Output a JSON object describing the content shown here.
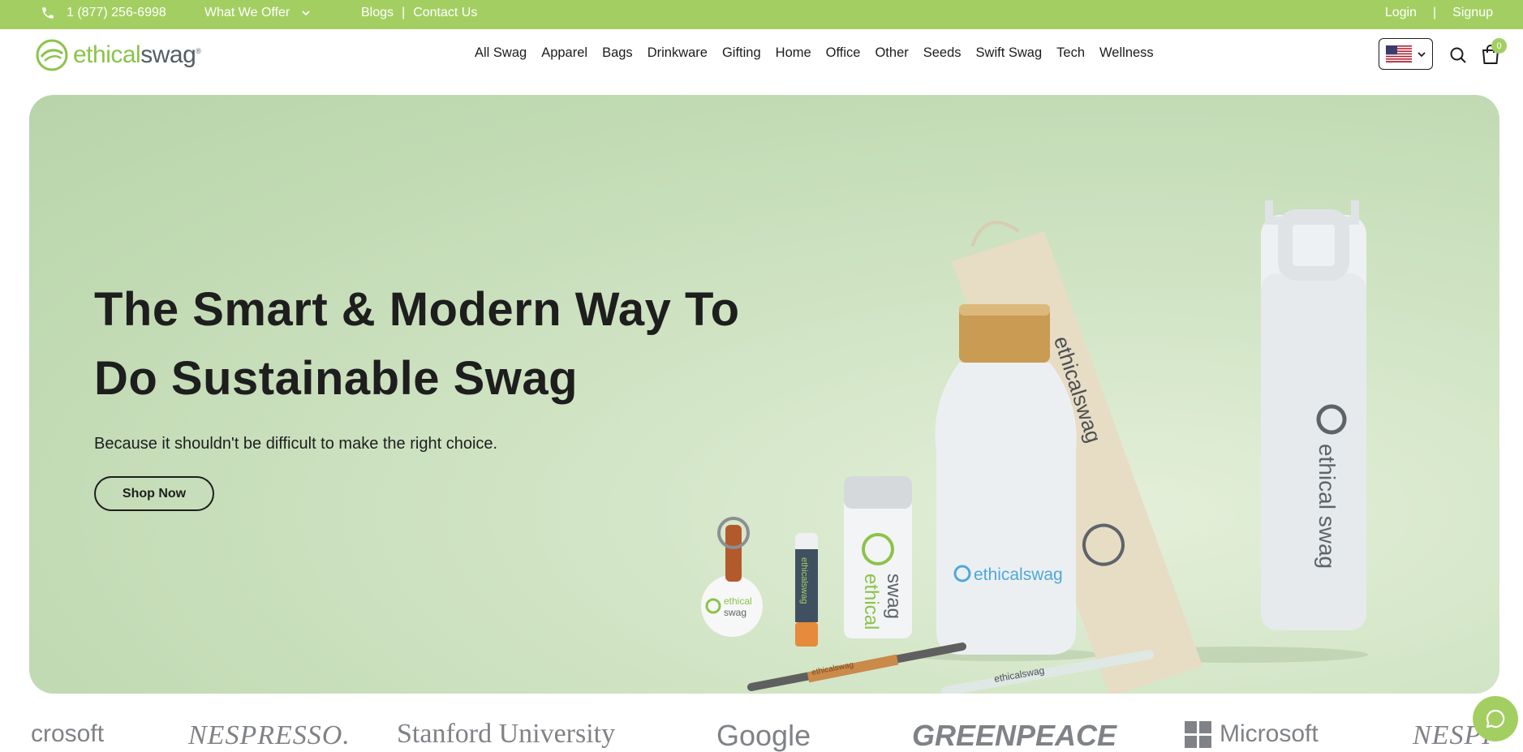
{
  "topbar": {
    "phone": "1 (877) 256-6998",
    "what_we_offer": "What We Offer",
    "blogs": "Blogs",
    "separator": "|",
    "contact": "Contact Us",
    "login": "Login",
    "signup": "Signup"
  },
  "header": {
    "logo_part1": "ethical",
    "logo_part2": "swag",
    "logo_reg": "®",
    "nav": [
      "All Swag",
      "Apparel",
      "Bags",
      "Drinkware",
      "Gifting",
      "Home",
      "Office",
      "Other",
      "Seeds",
      "Swift Swag",
      "Tech",
      "Wellness"
    ],
    "cart_count": "0",
    "country_flag": "us-flag-icon"
  },
  "hero": {
    "title_line1": "The Smart & Modern Way To",
    "title_line2": "Do Sustainable Swag",
    "subtitle": "Because it shouldn't be difficult to make the right choice.",
    "cta": "Shop Now",
    "product_labels": {
      "bottle": "ethicalswag",
      "pouch": "ethicalswag",
      "flask_1": "ethical",
      "flask_2": "swag",
      "battery_1": "ethical",
      "battery_2": "swag",
      "keychain_1": "ethical",
      "keychain_2": "swag",
      "lipbalm": "ethicalswag",
      "pen_1": "ethicalswag",
      "pen_2": "ethicalswag"
    }
  },
  "brands": [
    "crosoft",
    "NESPRESSO.",
    "Stanford University",
    "Google",
    "GREENPEACE",
    "Microsoft",
    "NESPI"
  ],
  "colors": {
    "accent": "#a3cf62",
    "brand_green": "#8bc34a",
    "brand_gray": "#555c63",
    "hero_bg": "#c6ddb8"
  }
}
